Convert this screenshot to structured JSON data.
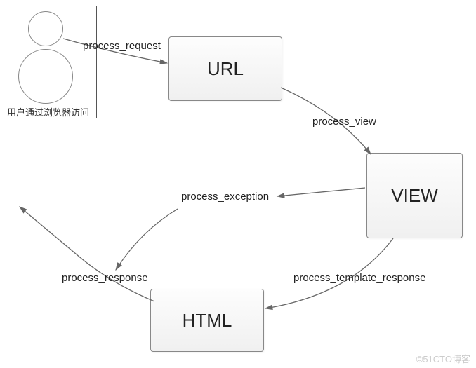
{
  "nodes": {
    "url": "URL",
    "view": "VIEW",
    "html": "HTML"
  },
  "edges": {
    "process_request": "process_request",
    "process_view": "process_view",
    "process_exception": "process_exception",
    "process_template_response": "process_template_response",
    "process_response": "process_response"
  },
  "user_caption": "用户通过浏览器访问",
  "watermark": "©51CTO博客"
}
